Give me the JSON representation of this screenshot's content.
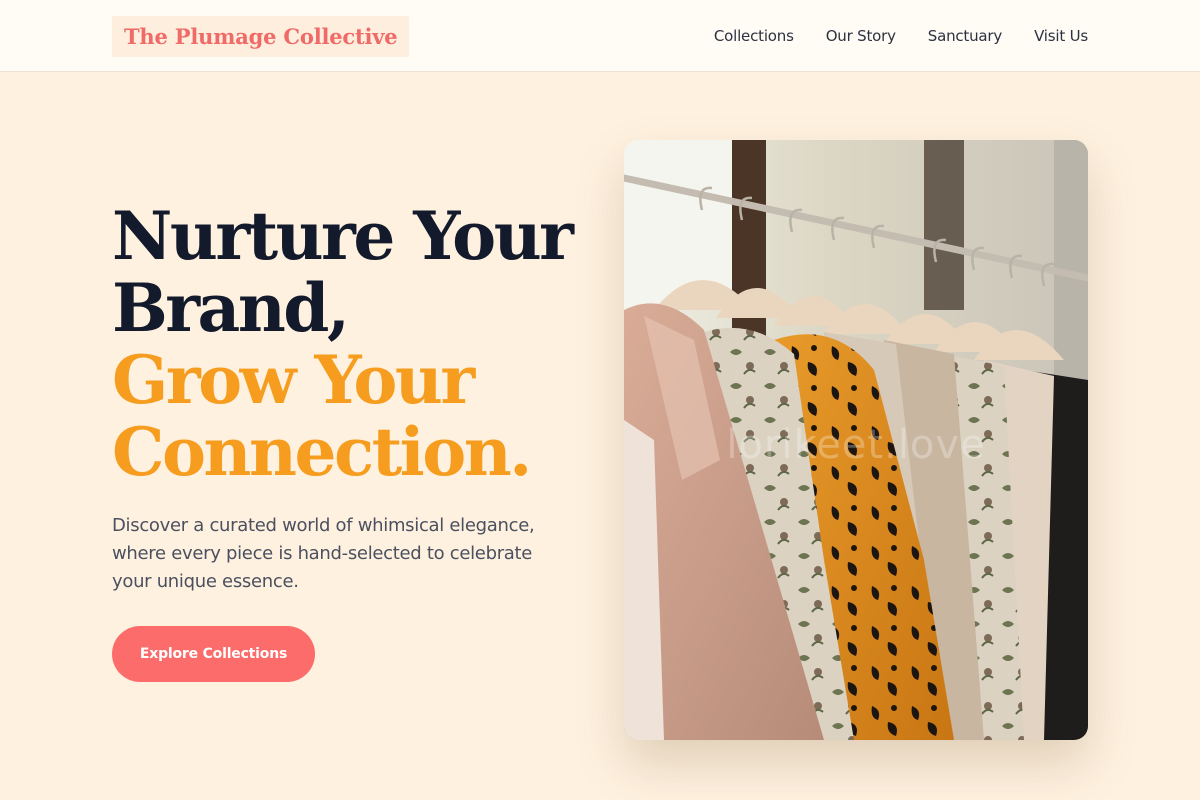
{
  "header": {
    "logo": "The Plumage Collective",
    "nav": [
      "Collections",
      "Our Story",
      "Sanctuary",
      "Visit Us"
    ]
  },
  "hero": {
    "headline_line1": "Nurture Your",
    "headline_line2": "Brand,",
    "headline_line3": "Grow Your",
    "headline_line4": "Connection.",
    "description": "Discover a curated world of whimsical elegance, where every piece is hand-selected to celebrate your unique essence.",
    "cta_label": "Explore Collections",
    "image_watermark": "lorikeet.love"
  },
  "colors": {
    "background": "#fef1df",
    "logo": "#f06a67",
    "accent": "#f69d1f",
    "heading": "#131a2c",
    "cta": "#fb6c6a"
  }
}
